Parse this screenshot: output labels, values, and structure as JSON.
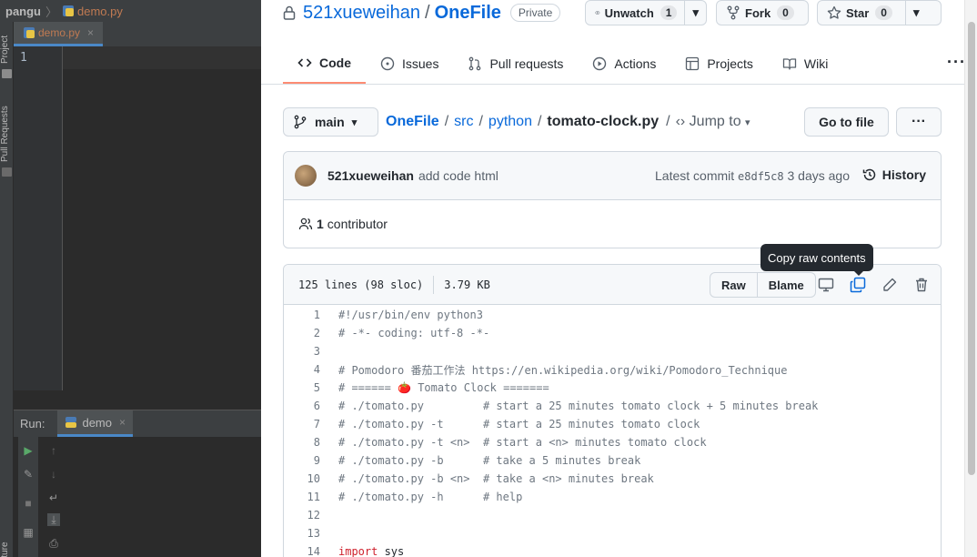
{
  "ide": {
    "project": "pangu",
    "breadcrumb_file": "demo.py",
    "tab_file": "demo.py",
    "line_numbers": [
      "1"
    ],
    "left_strip": [
      "Project",
      "Pull Requests",
      "Structure"
    ],
    "run_label": "Run:",
    "run_tab": "demo"
  },
  "repo": {
    "owner": "521xueweihan",
    "separator": "/",
    "name": "OneFile",
    "visibility": "Private",
    "unwatch_label": "Unwatch",
    "unwatch_count": "1",
    "fork_label": "Fork",
    "fork_count": "0",
    "star_label": "Star",
    "star_count": "0"
  },
  "nav": {
    "items": [
      "Code",
      "Issues",
      "Pull requests",
      "Actions",
      "Projects",
      "Wiki"
    ],
    "more": "···"
  },
  "file_nav": {
    "branch": "main",
    "path": [
      "OneFile",
      "src",
      "python"
    ],
    "current_file": "tomato-clock.py",
    "jump_to": "Jump to",
    "go_to_file": "Go to file",
    "more": "···"
  },
  "commit": {
    "author": "521xueweihan",
    "message": "add code html",
    "latest_label": "Latest commit",
    "sha": "e8df5c8",
    "time": "3 days ago",
    "history": "History",
    "contributors_count": "1",
    "contributors_label": "contributor"
  },
  "file": {
    "lines_info": "125 lines (98 sloc)",
    "size": "3.79 KB",
    "raw": "Raw",
    "blame": "Blame",
    "tooltip": "Copy raw contents",
    "code": [
      {
        "n": "1",
        "t": "#!/usr/bin/env python3",
        "kw": false
      },
      {
        "n": "2",
        "t": "# -*- coding: utf-8 -*-",
        "kw": false
      },
      {
        "n": "3",
        "t": "",
        "kw": false
      },
      {
        "n": "4",
        "t": "# Pomodoro 番茄工作法 https://en.wikipedia.org/wiki/Pomodoro_Technique",
        "kw": false
      },
      {
        "n": "5",
        "t": "# ====== 🍅 Tomato Clock =======",
        "kw": false
      },
      {
        "n": "6",
        "t": "# ./tomato.py         # start a 25 minutes tomato clock + 5 minutes break",
        "kw": false
      },
      {
        "n": "7",
        "t": "# ./tomato.py -t      # start a 25 minutes tomato clock",
        "kw": false
      },
      {
        "n": "8",
        "t": "# ./tomato.py -t <n>  # start a <n> minutes tomato clock",
        "kw": false
      },
      {
        "n": "9",
        "t": "# ./tomato.py -b      # take a 5 minutes break",
        "kw": false
      },
      {
        "n": "10",
        "t": "# ./tomato.py -b <n>  # take a <n> minutes break",
        "kw": false
      },
      {
        "n": "11",
        "t": "# ./tomato.py -h      # help",
        "kw": false
      },
      {
        "n": "12",
        "t": "",
        "kw": false
      },
      {
        "n": "13",
        "t": "",
        "kw": false
      },
      {
        "n": "14",
        "t": "import",
        "rest": " sys",
        "kw": true
      }
    ]
  },
  "colors": {
    "link": "#0969da",
    "active_tab_underline": "#fd8c73",
    "ide_bg": "#2b2b2b",
    "tooltip_bg": "#24292f"
  }
}
